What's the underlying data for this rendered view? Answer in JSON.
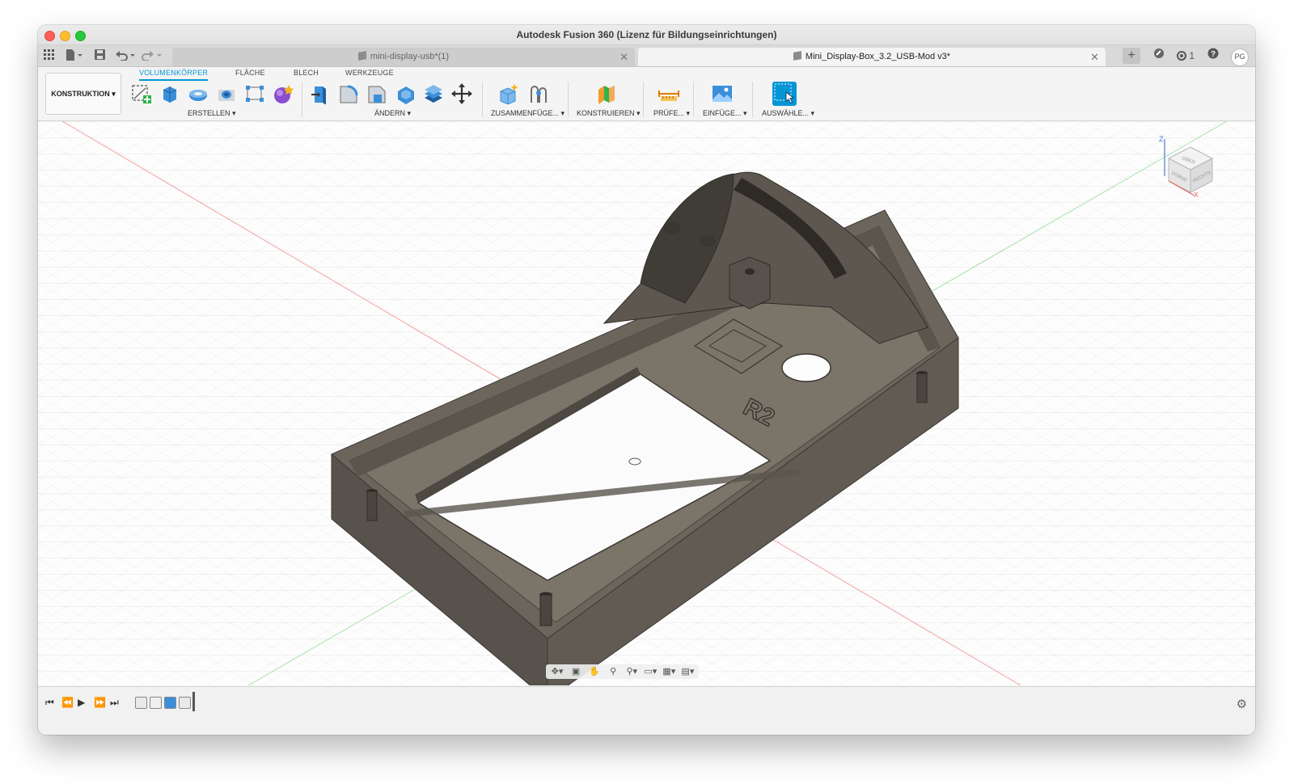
{
  "window": {
    "title": "Autodesk Fusion 360 (Lizenz für Bildungseinrichtungen)"
  },
  "tabs": [
    {
      "label": "mini-display-usb*(1)",
      "active": false
    },
    {
      "label": "Mini_Display-Box_3.2_USB-Mod v3*",
      "active": true
    }
  ],
  "toolbar_right": {
    "notifications": "1",
    "user_initials": "PG"
  },
  "ribbon": {
    "workspace": "KONSTRUKTION ▾",
    "tabs": [
      "VOLUMENKÖRPER",
      "FLÄCHE",
      "BLECH",
      "WERKZEUGE"
    ],
    "groups": {
      "erstellen": "ERSTELLEN ▾",
      "aendern": "ÄNDERN ▾",
      "zusammenfuegen": "ZUSAMMENFÜGE... ▾",
      "konstruieren": "KONSTRUIEREN ▾",
      "pruefen": "PRÜFE... ▾",
      "einfuegen": "EINFÜGE... ▾",
      "auswaehlen": "AUSWÄHLE... ▾"
    }
  },
  "viewcube": {
    "axis_z": "Z",
    "axis_x": "X",
    "top": "OBEN",
    "front": "VORNE",
    "right": "RECHTS"
  },
  "model": {
    "engraving": "R2"
  },
  "colors": {
    "accent": "#0696d7",
    "model": "#6f685e",
    "model_dark": "#4a453f",
    "grid": "#dcdcdc",
    "axis_red": "#f08a8a",
    "axis_green": "#8fd88f"
  }
}
